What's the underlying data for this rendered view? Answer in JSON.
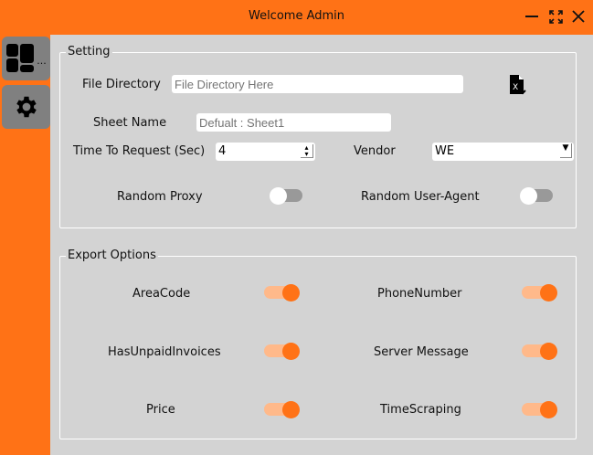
{
  "window": {
    "title": "Welcome Admin",
    "accent": "#ff7216"
  },
  "sidebar": {
    "items": [
      {
        "icon": "dashboard-icon",
        "label": "..."
      },
      {
        "icon": "gear-icon"
      }
    ]
  },
  "setting": {
    "title": "Setting",
    "file_directory": {
      "label": "File Directory",
      "placeholder": "File Directory Here",
      "value": ""
    },
    "sheet_name": {
      "label": "Sheet Name",
      "placeholder": "Defualt : Sheet1",
      "value": ""
    },
    "time_to_request": {
      "label": "Time To Request (Sec)",
      "value": "4"
    },
    "vendor": {
      "label": "Vendor",
      "value": "WE"
    },
    "random_proxy": {
      "label": "Random Proxy",
      "on": false
    },
    "random_user_agent": {
      "label": "Random User-Agent",
      "on": false
    }
  },
  "export": {
    "title": "Export Options",
    "options": [
      {
        "label": "AreaCode",
        "on": true
      },
      {
        "label": "PhoneNumber",
        "on": true
      },
      {
        "label": "HasUnpaidInvoices",
        "on": true
      },
      {
        "label": "Server Message",
        "on": true
      },
      {
        "label": "Price",
        "on": true
      },
      {
        "label": "TimeScraping",
        "on": true
      }
    ]
  }
}
